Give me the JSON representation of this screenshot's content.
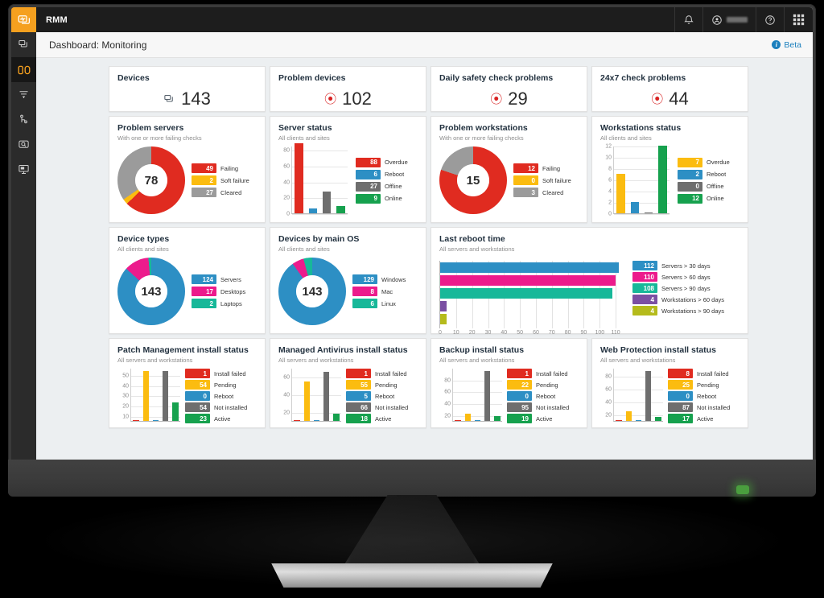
{
  "topbar": {
    "app_title": "RMM",
    "icons": [
      "bell-icon",
      "user-avatar-icon",
      "help-icon",
      "apps-grid-icon"
    ]
  },
  "rail": {
    "items": [
      {
        "name": "logo",
        "label": "RMM logo"
      },
      {
        "name": "devices",
        "label": "Devices"
      },
      {
        "name": "dashboard",
        "label": "Dashboard",
        "active": true
      },
      {
        "name": "filters",
        "label": "Filters"
      },
      {
        "name": "network",
        "label": "Network"
      },
      {
        "name": "monitoring-search",
        "label": "Monitoring search"
      },
      {
        "name": "reports",
        "label": "Reports"
      }
    ]
  },
  "header": {
    "page_title": "Dashboard: Monitoring",
    "beta_label": "Beta"
  },
  "kpis": [
    {
      "title": "Devices",
      "value": "143",
      "icon": "device-icon",
      "accent": "#3f4a54"
    },
    {
      "title": "Problem devices",
      "value": "102",
      "icon": "alert-icon",
      "accent": "#d82121"
    },
    {
      "title": "Daily safety check problems",
      "value": "29",
      "icon": "alert-icon",
      "accent": "#d82121"
    },
    {
      "title": "24x7 check problems",
      "value": "44",
      "icon": "alert-icon",
      "accent": "#d82121"
    }
  ],
  "chart_data": [
    {
      "type": "pie",
      "title": "Problem servers",
      "subtitle": "With one or more failing checks",
      "center_value": "78",
      "categories": [
        "Failing",
        "Soft failure",
        "Cleared"
      ],
      "values": [
        49,
        2,
        27
      ],
      "colors": [
        "#e02b20",
        "#fbbc10",
        "#9b9b9b"
      ],
      "legend": "right"
    },
    {
      "type": "bar",
      "title": "Server status",
      "subtitle": "All clients and sites",
      "categories": [
        "Overdue",
        "Reboot",
        "Offline",
        "Online"
      ],
      "values": [
        88,
        6,
        27,
        9
      ],
      "colors": [
        "#e02b20",
        "#2d8fc4",
        "#6e6e6e",
        "#16a14e"
      ],
      "ylim": [
        0,
        85
      ],
      "yticks": [
        0,
        20,
        40,
        60,
        80
      ],
      "grid": true,
      "legend": "right"
    },
    {
      "type": "pie",
      "title": "Problem workstations",
      "subtitle": "With one or more failing checks",
      "center_value": "15",
      "categories": [
        "Failing",
        "Soft failure",
        "Cleared"
      ],
      "values": [
        12,
        0,
        3
      ],
      "colors": [
        "#e02b20",
        "#fbbc10",
        "#9b9b9b"
      ],
      "legend": "right"
    },
    {
      "type": "bar",
      "title": "Workstations status",
      "subtitle": "All clients and sites",
      "categories": [
        "Overdue",
        "Reboot",
        "Offline",
        "Online"
      ],
      "values": [
        7,
        2,
        0,
        12
      ],
      "colors": [
        "#fbbc10",
        "#2d8fc4",
        "#6e6e6e",
        "#16a14e"
      ],
      "ylim": [
        0,
        12
      ],
      "yticks": [
        0,
        2,
        4,
        6,
        8,
        10,
        12
      ],
      "grid": true,
      "legend": "right"
    },
    {
      "type": "pie",
      "title": "Device types",
      "subtitle": "All clients and sites",
      "center_value": "143",
      "categories": [
        "Servers",
        "Desktops",
        "Laptops"
      ],
      "values": [
        124,
        17,
        2
      ],
      "colors": [
        "#2d8fc4",
        "#ec1b8c",
        "#17b899"
      ],
      "legend": "right"
    },
    {
      "type": "pie",
      "title": "Devices by main OS",
      "subtitle": "All clients and sites",
      "center_value": "143",
      "categories": [
        "Windows",
        "Mac",
        "Linux"
      ],
      "values": [
        129,
        8,
        6
      ],
      "colors": [
        "#2d8fc4",
        "#ec1b8c",
        "#17b899"
      ],
      "legend": "right"
    },
    {
      "type": "bar",
      "orientation": "horizontal",
      "title": "Last reboot time",
      "subtitle": "All servers and workstations",
      "categories": [
        "Servers > 30 days",
        "Servers > 60 days",
        "Servers > 90 days",
        "Workstations > 60 days",
        "Workstations > 90 days"
      ],
      "values": [
        112,
        110,
        108,
        4,
        4
      ],
      "colors": [
        "#2d8fc4",
        "#ec1b8c",
        "#17b899",
        "#7b4fa3",
        "#b5bb1c"
      ],
      "xlim": [
        0,
        115
      ],
      "xticks": [
        0,
        10,
        20,
        30,
        40,
        50,
        60,
        70,
        80,
        90,
        100,
        110
      ],
      "grid": true,
      "legend": "right"
    },
    {
      "type": "bar",
      "title": "Patch Management install status",
      "subtitle": "All servers and workstations",
      "categories": [
        "Install failed",
        "Pending",
        "Reboot",
        "Not installed",
        "Active"
      ],
      "values": [
        1,
        54,
        0,
        54,
        23
      ],
      "colors": [
        "#e02b20",
        "#fbbc10",
        "#2d8fc4",
        "#6e6e6e",
        "#16a14e"
      ],
      "ylim": [
        5,
        57
      ],
      "yticks": [
        10,
        20,
        30,
        40,
        50
      ],
      "grid": true,
      "legend": "right"
    },
    {
      "type": "bar",
      "title": "Managed Antivirus install status",
      "subtitle": "All servers and workstations",
      "categories": [
        "Install failed",
        "Pending",
        "Reboot",
        "Not installed",
        "Active"
      ],
      "values": [
        1,
        55,
        5,
        66,
        18
      ],
      "colors": [
        "#e02b20",
        "#fbbc10",
        "#2d8fc4",
        "#6e6e6e",
        "#16a14e"
      ],
      "ylim": [
        10,
        70
      ],
      "yticks": [
        20,
        40,
        60
      ],
      "grid": true,
      "legend": "right"
    },
    {
      "type": "bar",
      "title": "Backup install status",
      "subtitle": "All servers and workstations",
      "categories": [
        "Install failed",
        "Pending",
        "Reboot",
        "Not installed",
        "Active"
      ],
      "values": [
        1,
        22,
        0,
        95,
        19
      ],
      "colors": [
        "#e02b20",
        "#fbbc10",
        "#2d8fc4",
        "#6e6e6e",
        "#16a14e"
      ],
      "ylim": [
        10,
        100
      ],
      "yticks": [
        20,
        40,
        60,
        80
      ],
      "grid": true,
      "legend": "right"
    },
    {
      "type": "bar",
      "title": "Web Protection install status",
      "subtitle": "All servers and workstations",
      "categories": [
        "Install failed",
        "Pending",
        "Reboot",
        "Not installed",
        "Active"
      ],
      "values": [
        8,
        25,
        0,
        87,
        17
      ],
      "colors": [
        "#e02b20",
        "#fbbc10",
        "#2d8fc4",
        "#6e6e6e",
        "#16a14e"
      ],
      "ylim": [
        10,
        92
      ],
      "yticks": [
        20,
        40,
        60,
        80
      ],
      "grid": true,
      "legend": "right"
    }
  ]
}
